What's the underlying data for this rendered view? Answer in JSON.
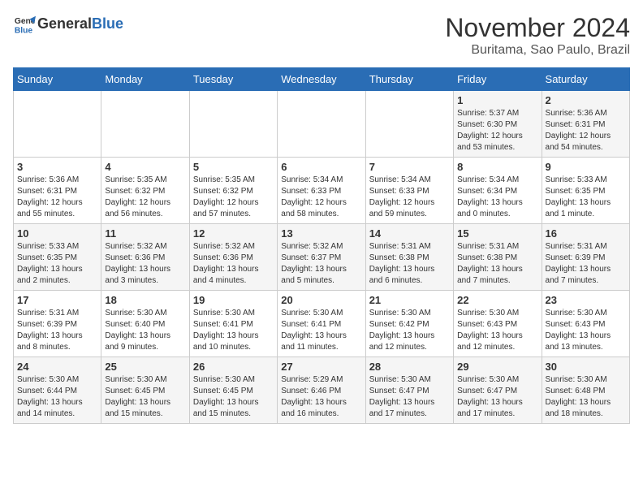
{
  "header": {
    "logo_general": "General",
    "logo_blue": "Blue",
    "month": "November 2024",
    "location": "Buritama, Sao Paulo, Brazil"
  },
  "weekdays": [
    "Sunday",
    "Monday",
    "Tuesday",
    "Wednesday",
    "Thursday",
    "Friday",
    "Saturday"
  ],
  "weeks": [
    [
      {
        "day": "",
        "info": ""
      },
      {
        "day": "",
        "info": ""
      },
      {
        "day": "",
        "info": ""
      },
      {
        "day": "",
        "info": ""
      },
      {
        "day": "",
        "info": ""
      },
      {
        "day": "1",
        "info": "Sunrise: 5:37 AM\nSunset: 6:30 PM\nDaylight: 12 hours\nand 53 minutes."
      },
      {
        "day": "2",
        "info": "Sunrise: 5:36 AM\nSunset: 6:31 PM\nDaylight: 12 hours\nand 54 minutes."
      }
    ],
    [
      {
        "day": "3",
        "info": "Sunrise: 5:36 AM\nSunset: 6:31 PM\nDaylight: 12 hours\nand 55 minutes."
      },
      {
        "day": "4",
        "info": "Sunrise: 5:35 AM\nSunset: 6:32 PM\nDaylight: 12 hours\nand 56 minutes."
      },
      {
        "day": "5",
        "info": "Sunrise: 5:35 AM\nSunset: 6:32 PM\nDaylight: 12 hours\nand 57 minutes."
      },
      {
        "day": "6",
        "info": "Sunrise: 5:34 AM\nSunset: 6:33 PM\nDaylight: 12 hours\nand 58 minutes."
      },
      {
        "day": "7",
        "info": "Sunrise: 5:34 AM\nSunset: 6:33 PM\nDaylight: 12 hours\nand 59 minutes."
      },
      {
        "day": "8",
        "info": "Sunrise: 5:34 AM\nSunset: 6:34 PM\nDaylight: 13 hours\nand 0 minutes."
      },
      {
        "day": "9",
        "info": "Sunrise: 5:33 AM\nSunset: 6:35 PM\nDaylight: 13 hours\nand 1 minute."
      }
    ],
    [
      {
        "day": "10",
        "info": "Sunrise: 5:33 AM\nSunset: 6:35 PM\nDaylight: 13 hours\nand 2 minutes."
      },
      {
        "day": "11",
        "info": "Sunrise: 5:32 AM\nSunset: 6:36 PM\nDaylight: 13 hours\nand 3 minutes."
      },
      {
        "day": "12",
        "info": "Sunrise: 5:32 AM\nSunset: 6:36 PM\nDaylight: 13 hours\nand 4 minutes."
      },
      {
        "day": "13",
        "info": "Sunrise: 5:32 AM\nSunset: 6:37 PM\nDaylight: 13 hours\nand 5 minutes."
      },
      {
        "day": "14",
        "info": "Sunrise: 5:31 AM\nSunset: 6:38 PM\nDaylight: 13 hours\nand 6 minutes."
      },
      {
        "day": "15",
        "info": "Sunrise: 5:31 AM\nSunset: 6:38 PM\nDaylight: 13 hours\nand 7 minutes."
      },
      {
        "day": "16",
        "info": "Sunrise: 5:31 AM\nSunset: 6:39 PM\nDaylight: 13 hours\nand 7 minutes."
      }
    ],
    [
      {
        "day": "17",
        "info": "Sunrise: 5:31 AM\nSunset: 6:39 PM\nDaylight: 13 hours\nand 8 minutes."
      },
      {
        "day": "18",
        "info": "Sunrise: 5:30 AM\nSunset: 6:40 PM\nDaylight: 13 hours\nand 9 minutes."
      },
      {
        "day": "19",
        "info": "Sunrise: 5:30 AM\nSunset: 6:41 PM\nDaylight: 13 hours\nand 10 minutes."
      },
      {
        "day": "20",
        "info": "Sunrise: 5:30 AM\nSunset: 6:41 PM\nDaylight: 13 hours\nand 11 minutes."
      },
      {
        "day": "21",
        "info": "Sunrise: 5:30 AM\nSunset: 6:42 PM\nDaylight: 13 hours\nand 12 minutes."
      },
      {
        "day": "22",
        "info": "Sunrise: 5:30 AM\nSunset: 6:43 PM\nDaylight: 13 hours\nand 12 minutes."
      },
      {
        "day": "23",
        "info": "Sunrise: 5:30 AM\nSunset: 6:43 PM\nDaylight: 13 hours\nand 13 minutes."
      }
    ],
    [
      {
        "day": "24",
        "info": "Sunrise: 5:30 AM\nSunset: 6:44 PM\nDaylight: 13 hours\nand 14 minutes."
      },
      {
        "day": "25",
        "info": "Sunrise: 5:30 AM\nSunset: 6:45 PM\nDaylight: 13 hours\nand 15 minutes."
      },
      {
        "day": "26",
        "info": "Sunrise: 5:30 AM\nSunset: 6:45 PM\nDaylight: 13 hours\nand 15 minutes."
      },
      {
        "day": "27",
        "info": "Sunrise: 5:29 AM\nSunset: 6:46 PM\nDaylight: 13 hours\nand 16 minutes."
      },
      {
        "day": "28",
        "info": "Sunrise: 5:30 AM\nSunset: 6:47 PM\nDaylight: 13 hours\nand 17 minutes."
      },
      {
        "day": "29",
        "info": "Sunrise: 5:30 AM\nSunset: 6:47 PM\nDaylight: 13 hours\nand 17 minutes."
      },
      {
        "day": "30",
        "info": "Sunrise: 5:30 AM\nSunset: 6:48 PM\nDaylight: 13 hours\nand 18 minutes."
      }
    ]
  ]
}
